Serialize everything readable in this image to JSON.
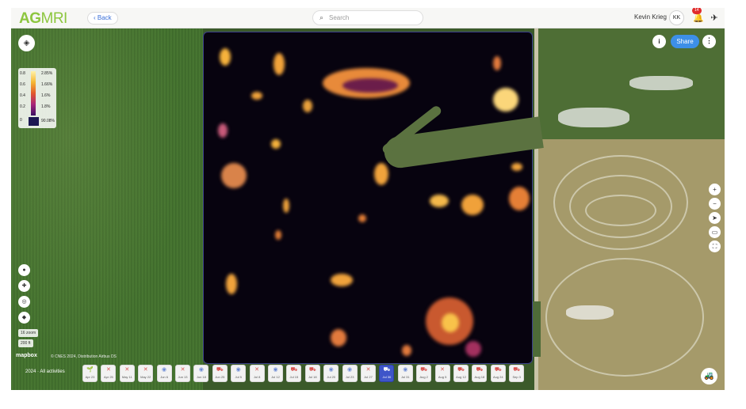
{
  "header": {
    "logo_text_a": "AG",
    "logo_text_b": "MRI",
    "back_label": "‹ Back",
    "search_placeholder": "Search",
    "user_name": "Kevin Krieg",
    "user_initials": "KK",
    "notification_count": "14"
  },
  "map": {
    "share_label": "Share",
    "legend": {
      "rows": [
        {
          "label": "0.8",
          "value": "2.85%"
        },
        {
          "label": "0.6",
          "value": "1.66%"
        },
        {
          "label": "0.4",
          "value": "1.6%"
        },
        {
          "label": "0.2",
          "value": "1.8%"
        },
        {
          "label": "0",
          "value": "90.08%"
        }
      ]
    },
    "scale_zoom": "16 zoom",
    "scale_distance": "200 ft",
    "mapbox_label": "mapbox",
    "attribution": "© CNES 2024, Distribution Airbus DS"
  },
  "timeline": {
    "label": "2024 · All activities",
    "chips": [
      {
        "icon": "sprout",
        "date": "Apr 23"
      },
      {
        "icon": "x",
        "date": "Apr 25"
      },
      {
        "icon": "x",
        "date": "May 11"
      },
      {
        "icon": "x",
        "date": "May 22"
      },
      {
        "icon": "circle",
        "date": "Jun 6"
      },
      {
        "icon": "x",
        "date": "Jun 13"
      },
      {
        "icon": "circle",
        "date": "Jun 18"
      },
      {
        "icon": "truck",
        "date": "Jun 25"
      },
      {
        "icon": "circle",
        "date": "Jul 5"
      },
      {
        "icon": "x",
        "date": "Jul 8"
      },
      {
        "icon": "circle",
        "date": "Jul 12"
      },
      {
        "icon": "truck",
        "date": "Jul 15"
      },
      {
        "icon": "truck",
        "date": "Jul 18"
      },
      {
        "icon": "circle",
        "date": "Jul 20"
      },
      {
        "icon": "circle",
        "date": "Jul 23"
      },
      {
        "icon": "x",
        "date": "Jul 27"
      },
      {
        "icon": "truck",
        "date": "Jul 30"
      },
      {
        "icon": "circle",
        "date": "Jul 31"
      },
      {
        "icon": "truck",
        "date": "Aug 2"
      },
      {
        "icon": "x",
        "date": "Aug 5"
      },
      {
        "icon": "truck",
        "date": "Aug 12"
      },
      {
        "icon": "truck",
        "date": "Aug 18"
      },
      {
        "icon": "truck",
        "date": "Aug 24"
      },
      {
        "icon": "truck",
        "date": "Sep 3"
      }
    ],
    "active_index": 16
  }
}
